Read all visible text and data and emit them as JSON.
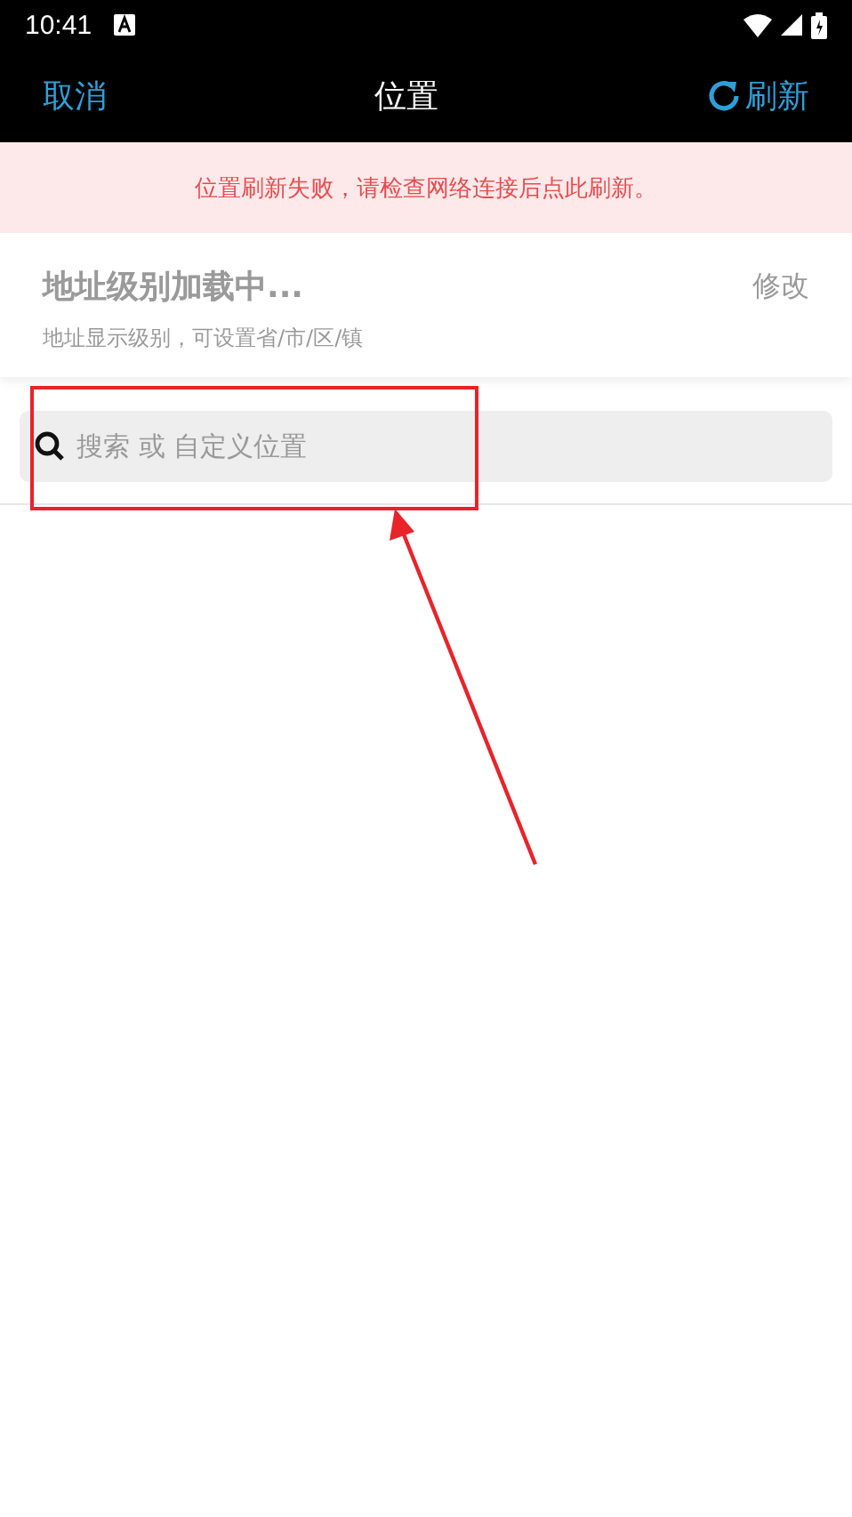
{
  "status_bar": {
    "time": "10:41"
  },
  "header": {
    "cancel": "取消",
    "title": "位置",
    "refresh": "刷新"
  },
  "error_banner": {
    "message": "位置刷新失败，请检查网络连接后点此刷新。"
  },
  "address_level": {
    "title": "地址级别加载中...",
    "subtitle": "地址显示级别，可设置省/市/区/镇",
    "action": "修改"
  },
  "search": {
    "placeholder": "搜索 或 自定义位置"
  },
  "annotation": {
    "highlight": true,
    "arrow": true
  }
}
